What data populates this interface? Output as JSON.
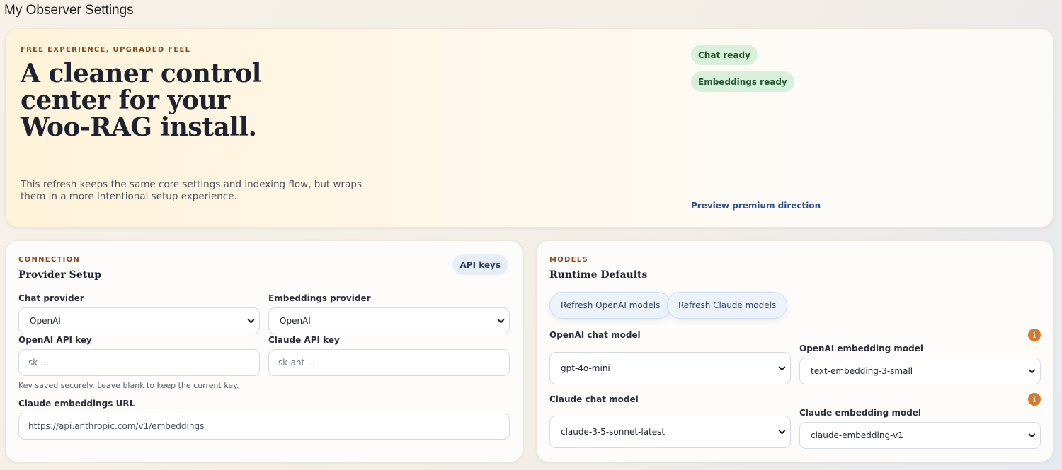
{
  "page": {
    "title": "My Observer Settings"
  },
  "hero": {
    "eyebrow": "FREE EXPERIENCE, UPGRADED FEEL",
    "heading": "A cleaner control center for your Woo-RAG install.",
    "description": "This refresh keeps the same core settings and indexing flow, but wraps them in a more intentional setup experience.",
    "status_chat": "Chat ready",
    "status_embeddings": "Embeddings ready",
    "preview_link": "Preview premium direction"
  },
  "connection": {
    "eyebrow": "CONNECTION",
    "title": "Provider Setup",
    "badge": "API keys",
    "chat_provider_label": "Chat provider",
    "chat_provider_value": "OpenAI",
    "embeddings_provider_label": "Embeddings provider",
    "embeddings_provider_value": "OpenAI",
    "openai_key_label": "OpenAI API key",
    "openai_key_placeholder": "sk-...",
    "claude_key_label": "Claude API key",
    "claude_key_placeholder": "sk-ant-...",
    "key_hint": "Key saved securely. Leave blank to keep the current key.",
    "claude_url_label": "Claude embeddings URL",
    "claude_url_value": "https://api.anthropic.com/v1/embeddings"
  },
  "models": {
    "eyebrow": "MODELS",
    "title": "Runtime Defaults",
    "refresh_openai": "Refresh OpenAI models",
    "refresh_claude": "Refresh Claude models",
    "openai_chat_label": "OpenAI chat model",
    "openai_chat_value": "gpt-4o-mini",
    "openai_embedding_label": "OpenAI embedding model",
    "openai_embedding_value": "text-embedding-3-small",
    "claude_chat_label": "Claude chat model",
    "claude_chat_value": "claude-3-5-sonnet-latest",
    "claude_embedding_label": "Claude embedding model",
    "claude_embedding_value": "claude-embedding-v1",
    "info_glyph": "i"
  }
}
